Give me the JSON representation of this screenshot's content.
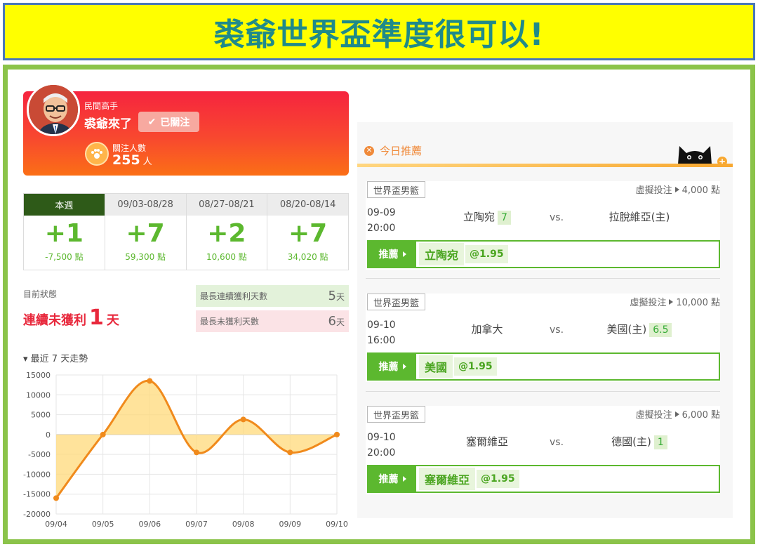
{
  "banner": {
    "title": "裘爺世界盃準度很可以!"
  },
  "profile": {
    "tier": "民間高手",
    "username": "裘爺來了",
    "follow_label": "已關注",
    "fans_label": "關注人數",
    "fans_count": "255",
    "fans_unit": "人"
  },
  "weekly": [
    {
      "period": "本週",
      "result": "+1",
      "points": "-7,500 點",
      "active": true
    },
    {
      "period": "09/03-08/28",
      "result": "+7",
      "points": "59,300 點",
      "active": false
    },
    {
      "period": "08/27-08/21",
      "result": "+2",
      "points": "10,600 點",
      "active": false
    },
    {
      "period": "08/20-08/14",
      "result": "+7",
      "points": "34,020 點",
      "active": false
    }
  ],
  "status": {
    "label": "目前狀態",
    "prefix": "連續未獲利",
    "number": "1",
    "suffix": "天",
    "longest_win_label": "最長連續獲利天數",
    "longest_win_value": "5",
    "longest_loss_label": "最長未獲利天數",
    "longest_loss_value": "6",
    "day_unit": "天"
  },
  "trend": {
    "title": "最近 7 天走勢"
  },
  "chart_data": {
    "type": "area",
    "categories": [
      "09/04",
      "09/05",
      "09/06",
      "09/07",
      "09/08",
      "09/09",
      "09/10"
    ],
    "values": [
      -16000,
      0,
      13500,
      -4500,
      3800,
      -4500,
      0
    ],
    "ylim": [
      -20000,
      15000
    ],
    "yticks": [
      15000,
      10000,
      5000,
      0,
      -5000,
      -10000,
      -15000,
      -20000
    ],
    "grid": true,
    "colors": {
      "line": "#f08a1c",
      "fill": "#ffd97a",
      "point": "#f08a1c"
    }
  },
  "recommend": {
    "title": "今日推薦",
    "pick_label": "推薦",
    "matches": [
      {
        "league": "世界盃男籃",
        "stake_label": "虛擬投注",
        "stake": "4,000 點",
        "date": "09-09",
        "time": "20:00",
        "team_a": "立陶宛",
        "score_a": "7",
        "vs": "vs.",
        "team_b": "拉脫維亞(主)",
        "score_b": "",
        "pick_team": "立陶宛",
        "pick_odds": "@1.95"
      },
      {
        "league": "世界盃男籃",
        "stake_label": "虛擬投注",
        "stake": "10,000 點",
        "date": "09-10",
        "time": "16:00",
        "team_a": "加拿大",
        "score_a": "",
        "vs": "vs.",
        "team_b": "美國(主)",
        "score_b": "6.5",
        "pick_team": "美國",
        "pick_odds": "@1.95"
      },
      {
        "league": "世界盃男籃",
        "stake_label": "虛擬投注",
        "stake": "6,000 點",
        "date": "09-10",
        "time": "20:00",
        "team_a": "塞爾維亞",
        "score_a": "",
        "vs": "vs.",
        "team_b": "德國(主)",
        "score_b": "1",
        "pick_team": "塞爾維亞",
        "pick_odds": "@1.95"
      }
    ]
  },
  "colors": {
    "accent_green": "#5cb82f",
    "brand_red": "#f6243f",
    "banner_yellow": "#ffff00",
    "frame_green": "#8bc34a"
  }
}
